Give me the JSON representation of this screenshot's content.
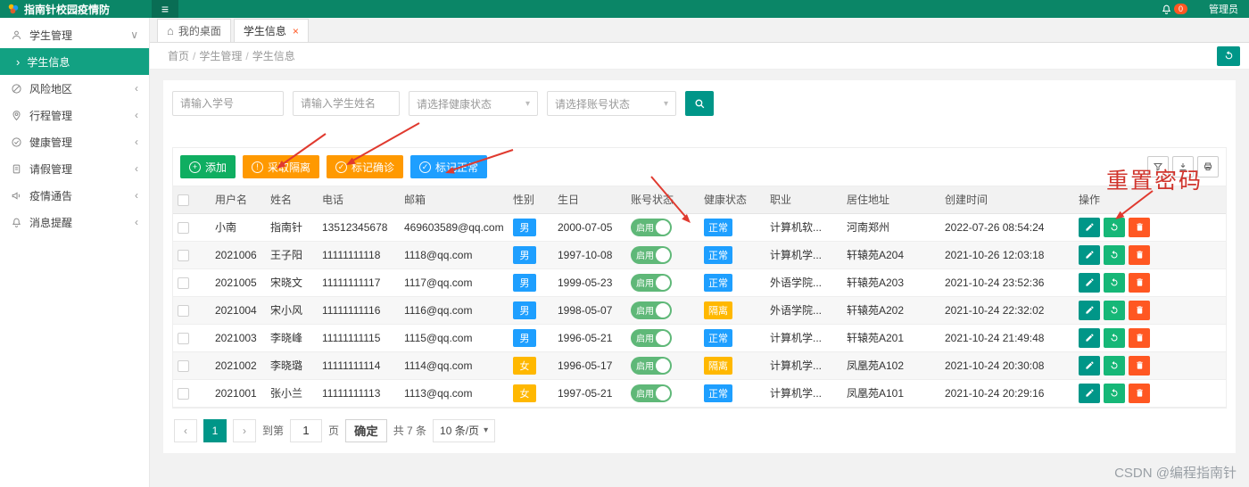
{
  "header": {
    "app_title": "指南针校园疫情防",
    "notification_count": "0",
    "username": "管理员"
  },
  "icons": {
    "hamburger": "≡",
    "home": "⌂",
    "chevron_down": "∨",
    "chevron_collapsed": "‹",
    "submenu_arrow": "›",
    "close": "×",
    "caret_down": "▾",
    "plus": "+",
    "exclaim": "!",
    "check": "✓"
  },
  "sidebar": {
    "items": [
      {
        "label": "学生管理",
        "state": "expanded"
      },
      {
        "label": "学生信息",
        "state": "active"
      },
      {
        "label": "风险地区",
        "state": "collapsed"
      },
      {
        "label": "行程管理",
        "state": "collapsed"
      },
      {
        "label": "健康管理",
        "state": "collapsed"
      },
      {
        "label": "请假管理",
        "state": "collapsed"
      },
      {
        "label": "疫情通告",
        "state": "collapsed"
      },
      {
        "label": "消息提醒",
        "state": "collapsed"
      }
    ]
  },
  "tabs": [
    {
      "label": "我的桌面",
      "active": false
    },
    {
      "label": "学生信息",
      "active": true
    }
  ],
  "breadcrumb": {
    "items": [
      "首页",
      "学生管理",
      "学生信息"
    ],
    "separator": "/"
  },
  "filters": {
    "student_id_placeholder": "请输入学号",
    "student_name_placeholder": "请输入学生姓名",
    "health_status_placeholder": "请选择健康状态",
    "account_status_placeholder": "请选择账号状态"
  },
  "toolbar": {
    "buttons": [
      {
        "label": "添加",
        "color": "#0fae61",
        "icon": "plus-circle-icon"
      },
      {
        "label": "采取隔离",
        "color": "#ff9900",
        "icon": "info-circle-icon"
      },
      {
        "label": "标记确诊",
        "color": "#ff9900",
        "icon": "check-circle-icon"
      },
      {
        "label": "标记正常",
        "color": "#1e9fff",
        "icon": "check-circle-icon"
      }
    ],
    "table_tools": [
      "filter-icon",
      "export-icon",
      "print-icon"
    ]
  },
  "annotations": {
    "reset_password_note": "重置密码",
    "arrow_color": "#e03a2f"
  },
  "table": {
    "columns": [
      "用户名",
      "姓名",
      "电话",
      "邮箱",
      "性别",
      "生日",
      "账号状态",
      "健康状态",
      "职业",
      "居住地址",
      "创建时间",
      "操作"
    ],
    "badge_colors": {
      "男": "#1e9fff",
      "女": "#ffb800",
      "正常": "#1e9fff",
      "隔离": "#ffb800"
    },
    "switch_color": "#5fb878",
    "rows": [
      {
        "username": "小南",
        "name": "指南针",
        "phone": "13512345678",
        "email": "469603589@qq.com",
        "gender": "男",
        "birthday": "2000-07-05",
        "account_status": "启用",
        "health_status": "正常",
        "occupation": "计算机软...",
        "address": "河南郑州",
        "created_at": "2022-07-26 08:54:24"
      },
      {
        "username": "2021006",
        "name": "王子阳",
        "phone": "11111111118",
        "email": "1118@qq.com",
        "gender": "男",
        "birthday": "1997-10-08",
        "account_status": "启用",
        "health_status": "正常",
        "occupation": "计算机学...",
        "address": "轩辕苑A204",
        "created_at": "2021-10-26 12:03:18"
      },
      {
        "username": "2021005",
        "name": "宋晓文",
        "phone": "11111111117",
        "email": "1117@qq.com",
        "gender": "男",
        "birthday": "1999-05-23",
        "account_status": "启用",
        "health_status": "正常",
        "occupation": "外语学院...",
        "address": "轩辕苑A203",
        "created_at": "2021-10-24 23:52:36"
      },
      {
        "username": "2021004",
        "name": "宋小风",
        "phone": "11111111116",
        "email": "1116@qq.com",
        "gender": "男",
        "birthday": "1998-05-07",
        "account_status": "启用",
        "health_status": "隔离",
        "occupation": "外语学院...",
        "address": "轩辕苑A202",
        "created_at": "2021-10-24 22:32:02"
      },
      {
        "username": "2021003",
        "name": "李晓峰",
        "phone": "11111111115",
        "email": "1115@qq.com",
        "gender": "男",
        "birthday": "1996-05-21",
        "account_status": "启用",
        "health_status": "正常",
        "occupation": "计算机学...",
        "address": "轩辕苑A201",
        "created_at": "2021-10-24 21:49:48"
      },
      {
        "username": "2021002",
        "name": "李晓璐",
        "phone": "11111111114",
        "email": "1114@qq.com",
        "gender": "女",
        "birthday": "1996-05-17",
        "account_status": "启用",
        "health_status": "隔离",
        "occupation": "计算机学...",
        "address": "凤凰苑A102",
        "created_at": "2021-10-24 20:30:08"
      },
      {
        "username": "2021001",
        "name": "张小兰",
        "phone": "11111111113",
        "email": "1113@qq.com",
        "gender": "女",
        "birthday": "1997-05-21",
        "account_status": "启用",
        "health_status": "正常",
        "occupation": "计算机学...",
        "address": "凤凰苑A101",
        "created_at": "2021-10-24 20:29:16"
      }
    ]
  },
  "pagination": {
    "prev": "‹",
    "next": "›",
    "current_page": "1",
    "goto_label": "到第",
    "goto_value": "1",
    "page_label": "页",
    "confirm_label": "确定",
    "total_label": "共 7 条",
    "per_page": "10 条/页"
  },
  "watermark": "CSDN @编程指南针",
  "theme": {
    "header_bg": "#0b8667",
    "active_menu_bg": "#12a182",
    "primary": "#009688"
  }
}
